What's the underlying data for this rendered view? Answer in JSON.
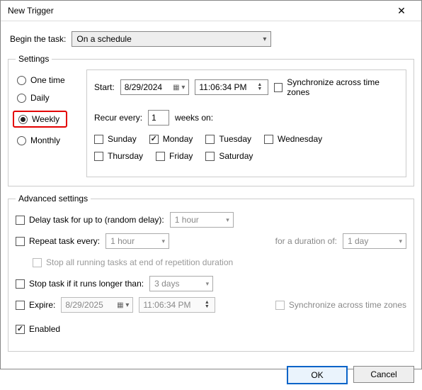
{
  "window": {
    "title": "New Trigger"
  },
  "begin": {
    "label": "Begin the task:",
    "value": "On a schedule"
  },
  "settings": {
    "legend": "Settings",
    "freq": {
      "one_time": "One time",
      "daily": "Daily",
      "weekly": "Weekly",
      "monthly": "Monthly",
      "selected": "weekly"
    },
    "start_label": "Start:",
    "start_date": "8/29/2024",
    "start_time": "11:06:34 PM",
    "sync_tz": "Synchronize across time zones",
    "recur_label": "Recur every:",
    "recur_value": "1",
    "weeks_on": "weeks on:",
    "days": {
      "sun": "Sunday",
      "mon": "Monday",
      "tue": "Tuesday",
      "wed": "Wednesday",
      "thu": "Thursday",
      "fri": "Friday",
      "sat": "Saturday"
    }
  },
  "advanced": {
    "legend": "Advanced settings",
    "delay_label": "Delay task for up to (random delay):",
    "delay_value": "1 hour",
    "repeat_label": "Repeat task every:",
    "repeat_value": "1 hour",
    "for_duration_label": "for a duration of:",
    "for_duration_value": "1 day",
    "stop_all_label": "Stop all running tasks at end of repetition duration",
    "stop_long_label": "Stop task if it runs longer than:",
    "stop_long_value": "3 days",
    "expire_label": "Expire:",
    "expire_date": "8/29/2025",
    "expire_time": "11:06:34 PM",
    "expire_sync": "Synchronize across time zones",
    "enabled_label": "Enabled"
  },
  "buttons": {
    "ok": "OK",
    "cancel": "Cancel"
  }
}
